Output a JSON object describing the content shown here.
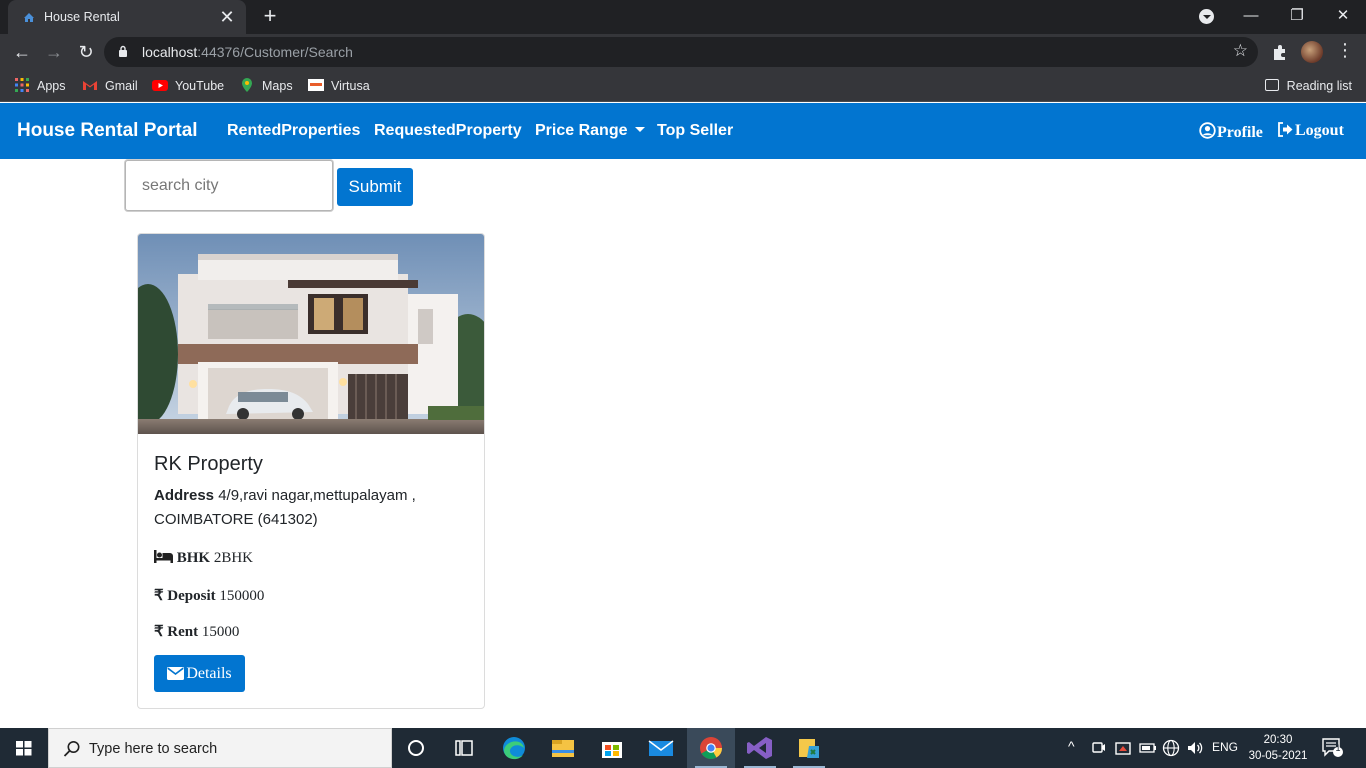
{
  "browser": {
    "tab_title": "House Rental",
    "url_host": "localhost",
    "url_path": ":44376/Customer/Search",
    "bookmarks": [
      "Apps",
      "Gmail",
      "YouTube",
      "Maps",
      "Virtusa"
    ],
    "reading_list": "Reading list"
  },
  "navbar": {
    "brand": "House Rental Portal",
    "links": [
      "RentedProperties",
      "RequestedProperty",
      "Price Range",
      "Top Seller"
    ],
    "profile": "Profile",
    "logout": "Logout"
  },
  "search": {
    "placeholder": "search city",
    "submit": "Submit"
  },
  "property": {
    "title": "RK Property",
    "address_label": "Address",
    "address": "4/9,ravi nagar,mettupalayam , COIMBATORE (641302)",
    "bhk_label": "BHK",
    "bhk": "2BHK",
    "deposit_label": "Deposit",
    "deposit": "150000",
    "rent_label": "Rent",
    "rent": "15000",
    "details_button": "Details"
  },
  "taskbar": {
    "search_placeholder": "Type here to search",
    "language": "ENG",
    "time": "20:30",
    "date": "30-05-2021",
    "notification_count": "1"
  },
  "colors": {
    "primary": "#0275d0",
    "chrome_dark": "#202124",
    "chrome_toolbar": "#35363a",
    "taskbar": "#1f2a35"
  }
}
